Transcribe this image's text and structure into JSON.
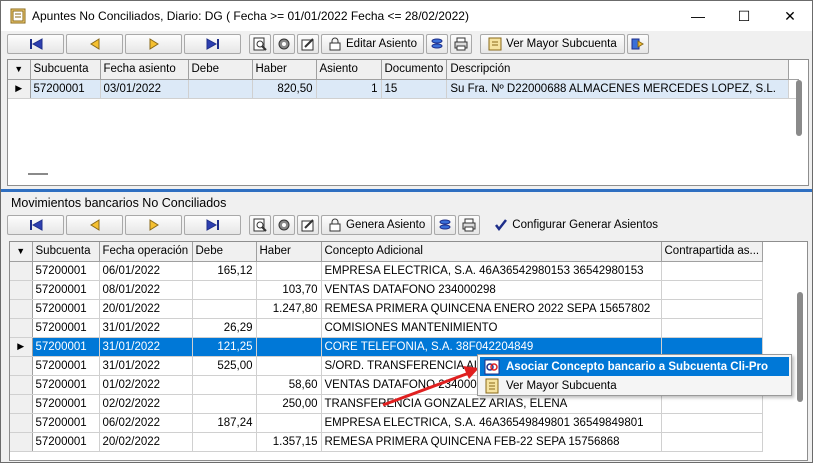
{
  "window": {
    "title": "Apuntes No Conciliados, Diario: DG  ( Fecha >= 01/01/2022 Fecha <= 28/02/2022)",
    "minimize": "—",
    "maximize": "☐",
    "close": "✕"
  },
  "toolbar_top": {
    "edit_label": "Editar Asiento",
    "ledger_label": "Ver Mayor Subcuenta"
  },
  "top_grid": {
    "columns": [
      "Subcuenta",
      "Fecha asiento",
      "Debe",
      "Haber",
      "Asiento",
      "Documento",
      "Descripción"
    ],
    "rows": [
      [
        "57200001",
        "03/01/2022",
        "",
        "820,50",
        "1",
        "15",
        "Su Fra. Nº D22000688 ALMACENES MERCEDES LOPEZ, S.L."
      ]
    ]
  },
  "section_bottom": {
    "label": "Movimientos bancarios No Conciliados"
  },
  "toolbar_bottom": {
    "generate_label": "Genera Asiento",
    "configure_label": "Configurar Generar Asientos"
  },
  "bottom_grid": {
    "columns": [
      "Subcuenta",
      "Fecha operación",
      "Debe",
      "Haber",
      "Concepto Adicional",
      "Contrapartida as..."
    ],
    "rows": [
      [
        "57200001",
        "06/01/2022",
        "165,12",
        "",
        "EMPRESA ELECTRICA, S.A. 46A36542980153 36542980153",
        ""
      ],
      [
        "57200001",
        "08/01/2022",
        "",
        "103,70",
        "VENTAS DATAFONO 234000298",
        ""
      ],
      [
        "57200001",
        "20/01/2022",
        "",
        "1.247,80",
        "REMESA PRIMERA QUINCENA ENERO 2022 SEPA 15657802",
        ""
      ],
      [
        "57200001",
        "31/01/2022",
        "26,29",
        "",
        "COMISIONES MANTENIMIENTO",
        ""
      ],
      [
        "57200001",
        "31/01/2022",
        "121,25",
        "",
        "CORE TELEFONIA, S.A. 38F042204849",
        ""
      ],
      [
        "57200001",
        "31/01/2022",
        "525,00",
        "",
        "S/ORD. TRANSFERENCIA ALQ",
        ""
      ],
      [
        "57200001",
        "01/02/2022",
        "",
        "58,60",
        "VENTAS DATAFONO 234000300",
        ""
      ],
      [
        "57200001",
        "02/02/2022",
        "",
        "250,00",
        "TRANSFERENCIA GONZALEZ ARIAS, ELENA",
        ""
      ],
      [
        "57200001",
        "06/02/2022",
        "187,24",
        "",
        "EMPRESA ELECTRICA, S.A. 46A36549849801 36549849801",
        ""
      ],
      [
        "57200001",
        "20/02/2022",
        "",
        "1.357,15",
        "REMESA PRIMERA QUINCENA FEB-22 SEPA 15756868",
        ""
      ]
    ],
    "selected_row": 4
  },
  "context_menu": {
    "items": [
      {
        "label": "Asociar Concepto bancario a Subcuenta Cli-Pro",
        "icon": "link-icon"
      },
      {
        "label": "Ver Mayor Subcuenta",
        "icon": "ledger-icon"
      }
    ]
  },
  "colors": {
    "accent": "#0078d7",
    "selection_light": "#dce9f7",
    "annotation_arrow": "#e02020"
  }
}
